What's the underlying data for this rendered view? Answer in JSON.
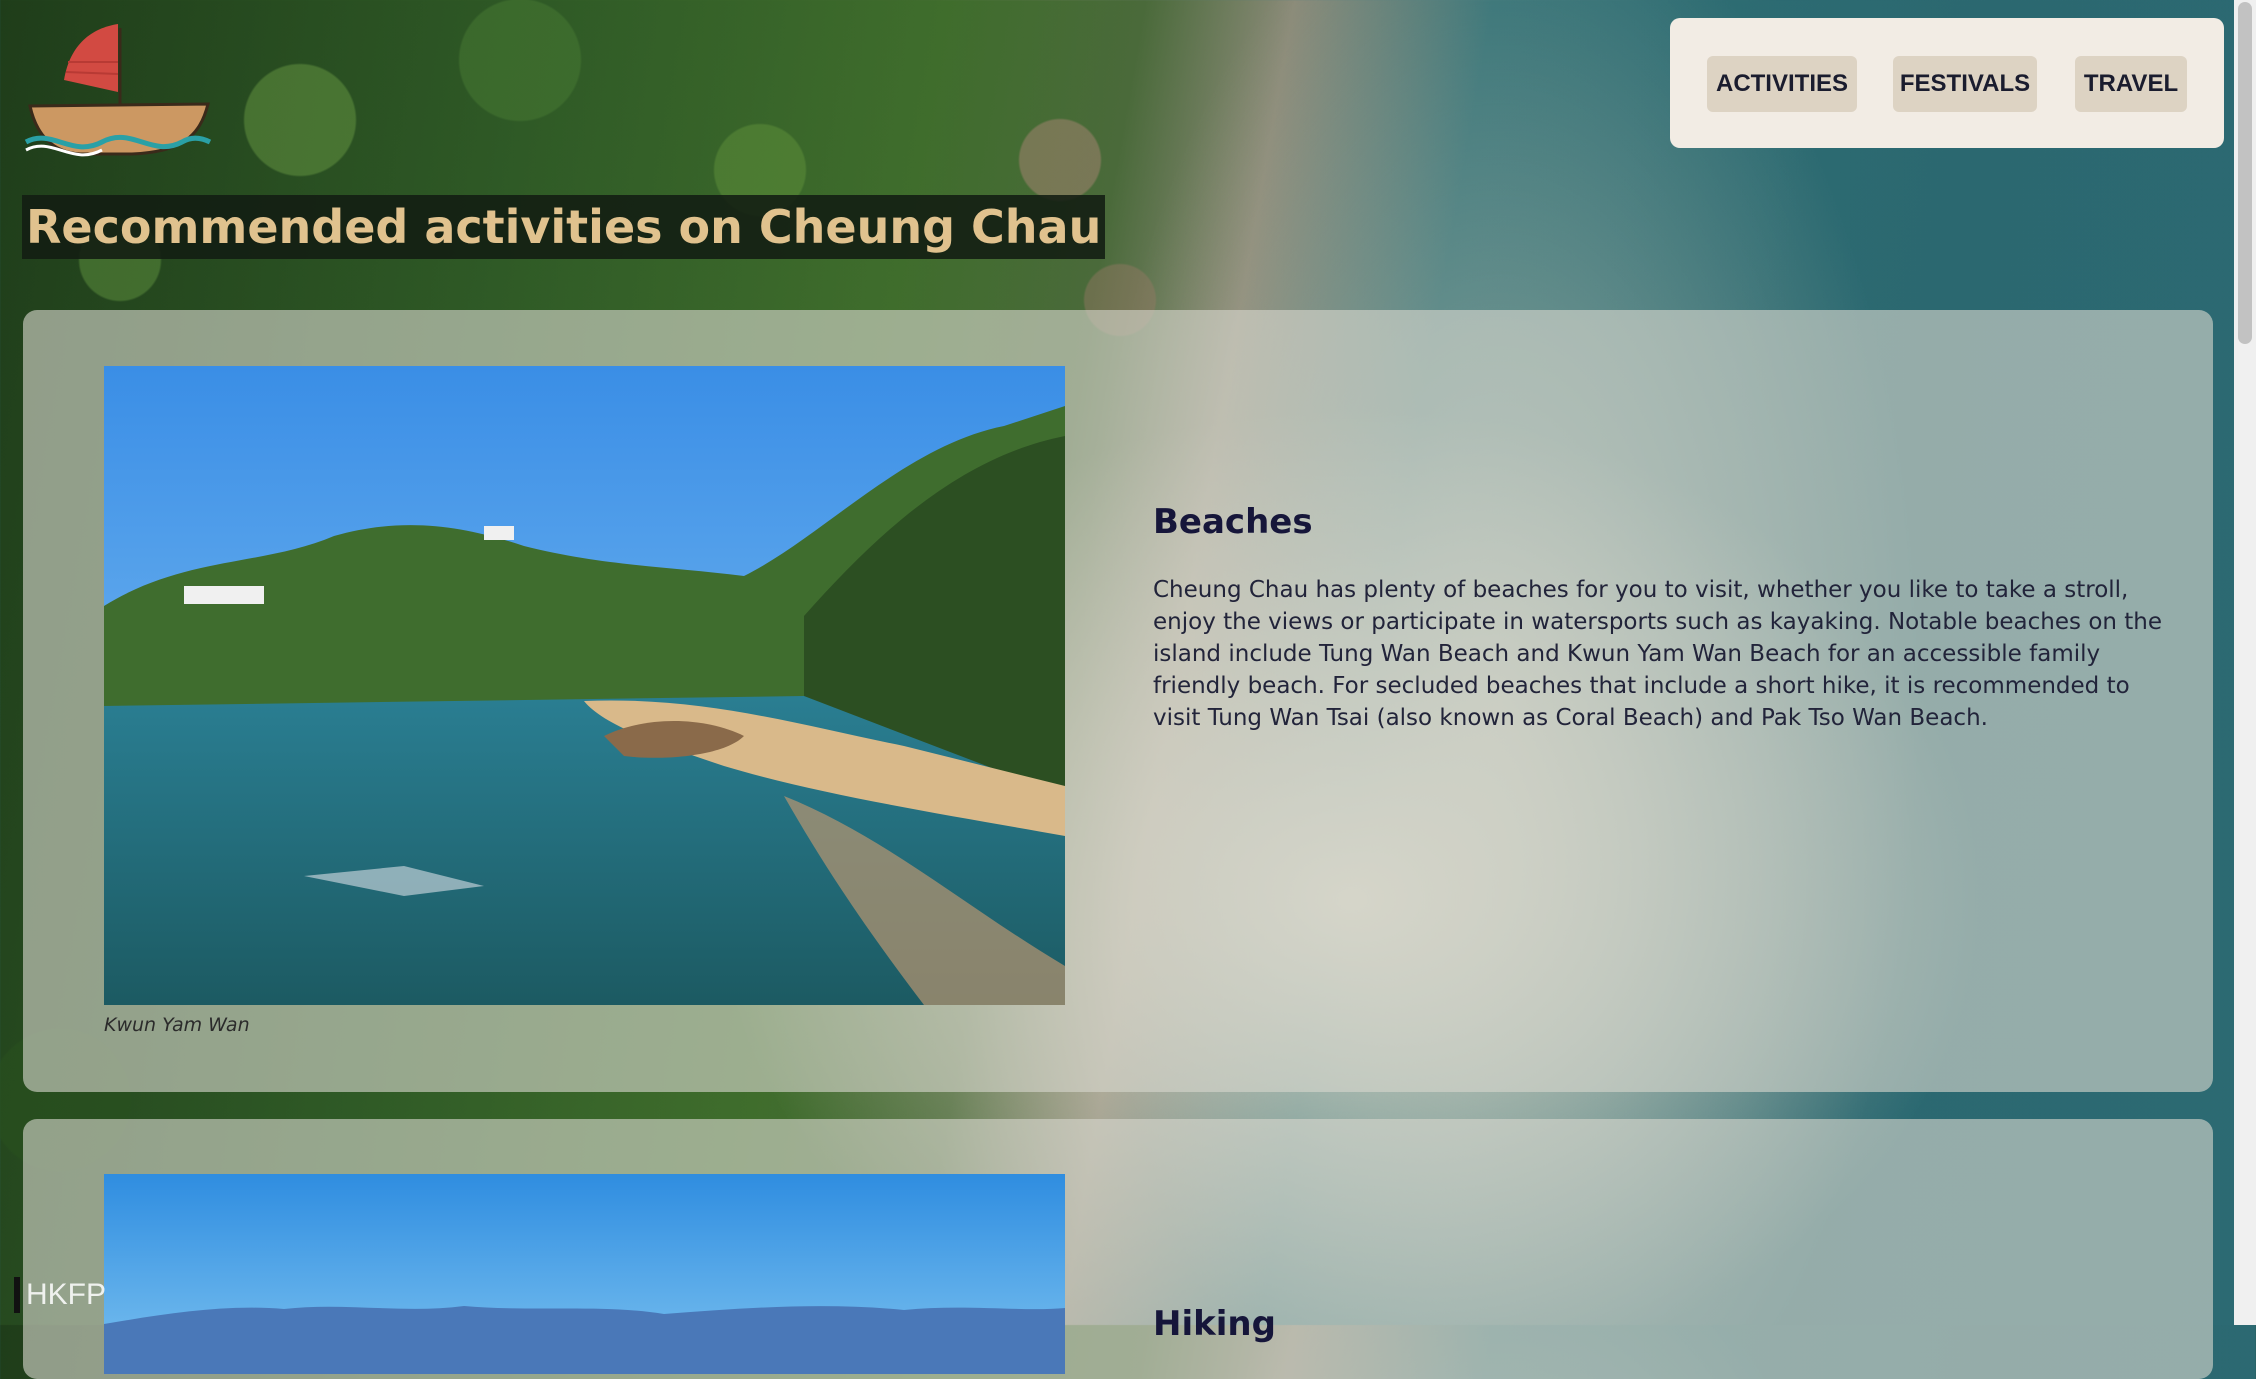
{
  "nav": {
    "items": [
      {
        "label": "ACTIVITIES"
      },
      {
        "label": "FESTIVALS"
      },
      {
        "label": "TRAVEL"
      }
    ]
  },
  "page": {
    "title": "Recommended activities on Cheung Chau"
  },
  "sections": [
    {
      "heading": "Beaches",
      "caption": "Kwun Yam Wan",
      "text": "Cheung Chau has plenty of beaches for you to visit, whether you like to take a stroll, enjoy the views or participate in watersports such as kayaking. Notable beaches on the island include Tung Wan Beach and Kwun Yam Wan Beach for an accessible family friendly beach. For secluded beaches that include a short hike, it is recommended to visit Tung Wan Tsai (also known as Coral Beach) and Pak Tso Wan Beach."
    },
    {
      "heading": "Hiking"
    }
  ],
  "watermark": {
    "text": "HKFP"
  },
  "icons": {
    "logo": "sailboat-logo-icon"
  },
  "colors": {
    "title_text": "#e0c28e",
    "nav_bg": "#f2ece4",
    "nav_button": "#ddd3c3",
    "heading_text": "#16163a"
  }
}
